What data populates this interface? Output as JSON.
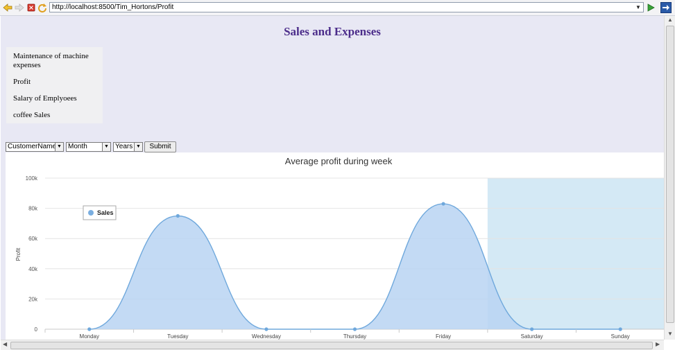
{
  "browser": {
    "url": "http://localhost:8500/Tim_Hortons/Profit",
    "icons": [
      "back-arrow-icon",
      "forward-arrow-icon",
      "stop-icon",
      "refresh-icon",
      "dropdown-icon",
      "go-arrow-icon",
      "compatibility-icon"
    ]
  },
  "page": {
    "title": "Sales and Expenses",
    "menu": [
      {
        "label": "Maintenance of machine expenses"
      },
      {
        "label": "Profit"
      },
      {
        "label": "Salary of Emplyoees"
      },
      {
        "label": "coffee Sales"
      }
    ]
  },
  "filters": {
    "customer": "CustomerName",
    "month": "Month",
    "years": "Years",
    "submit": "Submit"
  },
  "colors": {
    "title": "#4b2c8a",
    "series_fill": "#b8d4f2",
    "series_line": "#6fa8dc",
    "highlight_band": "#d4e9f5"
  },
  "chart_data": {
    "type": "area",
    "title": "Average profit during week",
    "ylabel": "Profit",
    "xlabel": "",
    "categories": [
      "Monday",
      "Tuesday",
      "Wednesday",
      "Thursday",
      "Friday",
      "Saturday",
      "Sunday"
    ],
    "series": [
      {
        "name": "Sales",
        "values": [
          0,
          75000,
          0,
          0,
          83000,
          0,
          0
        ]
      }
    ],
    "ylim": [
      0,
      100000
    ],
    "yticks": [
      "0",
      "20k",
      "40k",
      "60k",
      "80k",
      "100k"
    ],
    "highlight_range": [
      "Friday",
      "Sunday"
    ],
    "grid": true,
    "legend_position": "top-left"
  }
}
